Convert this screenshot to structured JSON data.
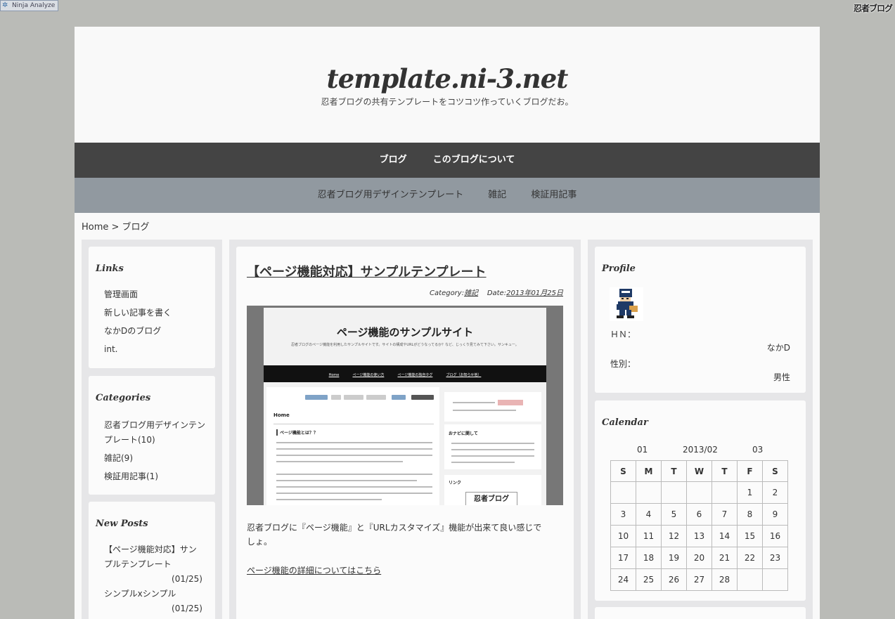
{
  "toolbar": {
    "ninja_analyze": "Ninja Analyze",
    "ninja_logo": "忍者ブログ"
  },
  "header": {
    "title": "template.ni-3.net",
    "description": "忍者ブログの共有テンプレートをコツコツ作っていくブログだお。"
  },
  "nav_primary": [
    "ブログ",
    "このブログについて"
  ],
  "nav_secondary": [
    "忍者ブログ用デザインテンプレート",
    "雑記",
    "検証用記事"
  ],
  "breadcrumb": "Home > ブログ",
  "links": {
    "title": "Links",
    "items": [
      "管理画面",
      "新しい記事を書く",
      "なかDのブログ",
      "int."
    ]
  },
  "categories": {
    "title": "Categories",
    "items": [
      "忍者ブログ用デザインテンプレート(10)",
      "雑記(9)",
      "検証用記事(1)"
    ]
  },
  "new_posts": {
    "title": "New Posts",
    "items": [
      {
        "title": "【ページ機能対応】サンプルテンプレート",
        "date": "(01/25)"
      },
      {
        "title": "シンプルxシンプル",
        "date": "(01/25)"
      }
    ]
  },
  "post": {
    "title": "【ページ機能対応】サンプルテンプレート",
    "category_label": "Category:",
    "category": "雑記",
    "date_label": "Date:",
    "date": "2013年01月25日",
    "body": "忍者ブログに『ページ機能』と『URLカスタマイズ』機能が出来て良い感じでしょ。",
    "link": "ページ機能の詳細についてはこちら",
    "thumbnail": {
      "title": "ページ機能のサンプルサイト",
      "subtitle": "忍者ブログのページ機能を利用したサンプルサイトです。サイトの構成やURLがどうなってるか？など、じっくり見てみて下さい。サンキュー。",
      "nav": [
        "Home",
        "ページ機能の使い方",
        "ページ機能の独自タグ",
        "ブログ（お知らせ他）"
      ],
      "heading": "Home",
      "subheading": "ページ機能とは？？",
      "side_nav": "おナビに関して",
      "side_link": "リンク",
      "logo": "忍者ブログ"
    }
  },
  "profile": {
    "title": "Profile",
    "hn_label": "ＨＮ：",
    "hn_value": "なかD",
    "gender_label": "性別：",
    "gender_value": "男性"
  },
  "calendar": {
    "title": "Calendar",
    "prev": "01",
    "current": "2013/02",
    "next": "03",
    "weekdays": [
      "S",
      "M",
      "T",
      "W",
      "T",
      "F",
      "S"
    ],
    "weeks": [
      [
        "",
        "",
        "",
        "",
        "",
        "1",
        "2"
      ],
      [
        "3",
        "4",
        "5",
        "6",
        "7",
        "8",
        "9"
      ],
      [
        "10",
        "11",
        "12",
        "13",
        "14",
        "15",
        "16"
      ],
      [
        "17",
        "18",
        "19",
        "20",
        "21",
        "22",
        "23"
      ],
      [
        "24",
        "25",
        "26",
        "27",
        "28",
        "",
        ""
      ]
    ]
  }
}
